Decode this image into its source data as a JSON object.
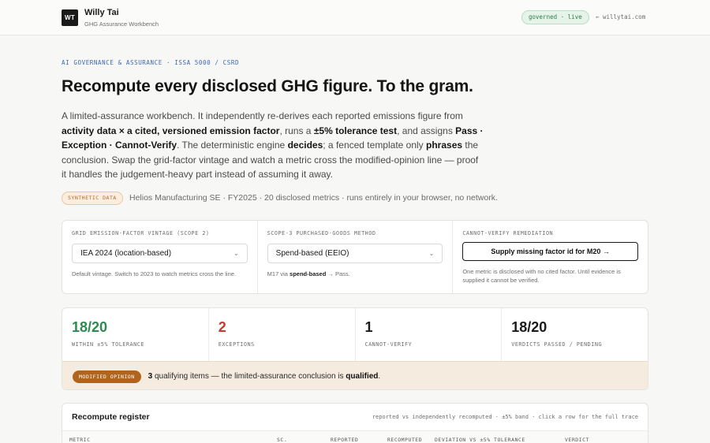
{
  "header": {
    "logo_initials": "WT",
    "name": "Willy Tai",
    "subtitle": "GHG Assurance Workbench",
    "status_pill": "governed · live",
    "back_link": "← willytai.com"
  },
  "hero": {
    "eyebrow": "AI GOVERNANCE & ASSURANCE · ISSA 5000 / CSRD",
    "title": "Recompute every disclosed GHG figure. To the gram.",
    "intro": [
      {
        "t": "A limited-assurance workbench. It independently re-derives each reported emissions figure from ",
        "b": false
      },
      {
        "t": "activity data × a cited, versioned emission factor",
        "b": true
      },
      {
        "t": ", runs a ",
        "b": false
      },
      {
        "t": "±5% tolerance test",
        "b": true
      },
      {
        "t": ", and assigns ",
        "b": false
      },
      {
        "t": "Pass · Exception · Cannot-Verify",
        "b": true
      },
      {
        "t": ". The deterministic engine ",
        "b": false
      },
      {
        "t": "decides",
        "b": true
      },
      {
        "t": "; a fenced template only ",
        "b": false
      },
      {
        "t": "phrases",
        "b": true
      },
      {
        "t": " the conclusion. Swap the grid-factor vintage and watch a metric cross the modified-opinion line — proof it handles the judgement-heavy part instead of assuming it away.",
        "b": false
      }
    ],
    "synthetic_tag": "SYNTHETIC DATA",
    "synthetic_text": "Helios Manufacturing SE · FY2025 · 20 disclosed metrics · runs entirely in your browser, no network."
  },
  "controls": {
    "grid": {
      "label": "GRID EMISSION-FACTOR VINTAGE (SCOPE 2)",
      "value": "IEA 2024 (location-based)",
      "help": "Default vintage. Switch to 2023 to watch metrics cross the line."
    },
    "scope3": {
      "label": "SCOPE-3 PURCHASED-GOODS METHOD",
      "value": "Spend-based (EEIO)",
      "help_prefix": "M17 via ",
      "help_bold": "spend-based",
      "help_suffix": " → Pass."
    },
    "remediation": {
      "label": "CANNOT-VERIFY REMEDIATION",
      "button": "Supply missing factor id for M20 →",
      "help": "One metric is disclosed with no cited factor. Until evidence is supplied it cannot be verified."
    }
  },
  "stats": [
    {
      "value": "18/20",
      "label": "WITHIN ±5% TOLERANCE",
      "tone": "green"
    },
    {
      "value": "2",
      "label": "EXCEPTIONS",
      "tone": "red"
    },
    {
      "value": "1",
      "label": "CANNOT-VERIFY",
      "tone": "neutral"
    },
    {
      "value": "18/20",
      "label": "VERDICTS PASSED / PENDING",
      "tone": "neutral"
    }
  ],
  "opinion": {
    "tag": "MODIFIED OPINION",
    "count": "3",
    "text_mid": " qualifying items — the limited-assurance conclusion is ",
    "verdict": "qualified",
    "end": "."
  },
  "register": {
    "title": "Recompute register",
    "note": "reported vs independently recomputed · ±5% band · click a row for the full trace",
    "columns": [
      "METRIC",
      "SC.",
      "REPORTED",
      "RECOMPUTED",
      "DEVIATION VS ±5% TOLERANCE",
      "VERDICT"
    ]
  },
  "colors": {
    "accent_blue": "#3e67b5",
    "pass_green": "#2f8a4f",
    "exception_red": "#c63a2f",
    "opinion_amber": "#b0651f"
  }
}
